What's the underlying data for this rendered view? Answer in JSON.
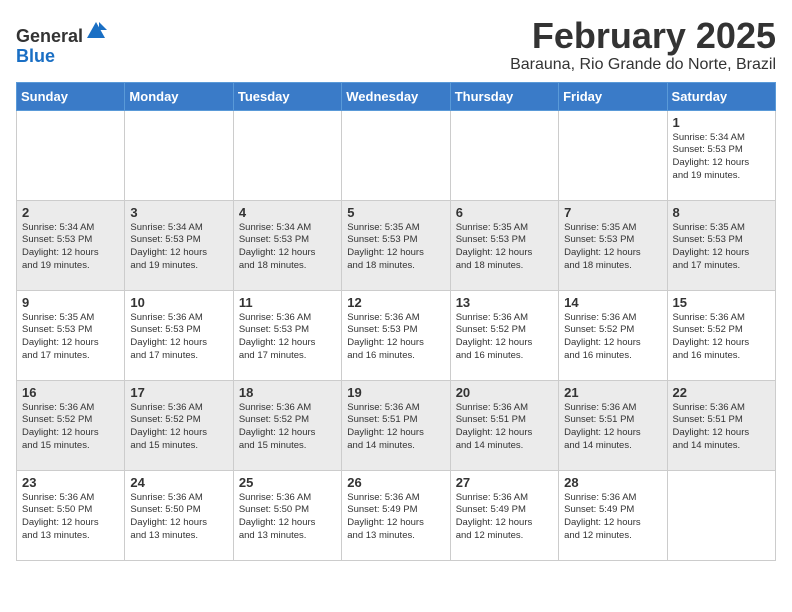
{
  "header": {
    "logo_general": "General",
    "logo_blue": "Blue",
    "month_title": "February 2025",
    "location": "Barauna, Rio Grande do Norte, Brazil"
  },
  "weekdays": [
    "Sunday",
    "Monday",
    "Tuesday",
    "Wednesday",
    "Thursday",
    "Friday",
    "Saturday"
  ],
  "weeks": [
    [
      {
        "day": "",
        "info": ""
      },
      {
        "day": "",
        "info": ""
      },
      {
        "day": "",
        "info": ""
      },
      {
        "day": "",
        "info": ""
      },
      {
        "day": "",
        "info": ""
      },
      {
        "day": "",
        "info": ""
      },
      {
        "day": "1",
        "info": "Sunrise: 5:34 AM\nSunset: 5:53 PM\nDaylight: 12 hours\nand 19 minutes."
      }
    ],
    [
      {
        "day": "2",
        "info": "Sunrise: 5:34 AM\nSunset: 5:53 PM\nDaylight: 12 hours\nand 19 minutes."
      },
      {
        "day": "3",
        "info": "Sunrise: 5:34 AM\nSunset: 5:53 PM\nDaylight: 12 hours\nand 19 minutes."
      },
      {
        "day": "4",
        "info": "Sunrise: 5:34 AM\nSunset: 5:53 PM\nDaylight: 12 hours\nand 18 minutes."
      },
      {
        "day": "5",
        "info": "Sunrise: 5:35 AM\nSunset: 5:53 PM\nDaylight: 12 hours\nand 18 minutes."
      },
      {
        "day": "6",
        "info": "Sunrise: 5:35 AM\nSunset: 5:53 PM\nDaylight: 12 hours\nand 18 minutes."
      },
      {
        "day": "7",
        "info": "Sunrise: 5:35 AM\nSunset: 5:53 PM\nDaylight: 12 hours\nand 18 minutes."
      },
      {
        "day": "8",
        "info": "Sunrise: 5:35 AM\nSunset: 5:53 PM\nDaylight: 12 hours\nand 17 minutes."
      }
    ],
    [
      {
        "day": "9",
        "info": "Sunrise: 5:35 AM\nSunset: 5:53 PM\nDaylight: 12 hours\nand 17 minutes."
      },
      {
        "day": "10",
        "info": "Sunrise: 5:36 AM\nSunset: 5:53 PM\nDaylight: 12 hours\nand 17 minutes."
      },
      {
        "day": "11",
        "info": "Sunrise: 5:36 AM\nSunset: 5:53 PM\nDaylight: 12 hours\nand 17 minutes."
      },
      {
        "day": "12",
        "info": "Sunrise: 5:36 AM\nSunset: 5:53 PM\nDaylight: 12 hours\nand 16 minutes."
      },
      {
        "day": "13",
        "info": "Sunrise: 5:36 AM\nSunset: 5:52 PM\nDaylight: 12 hours\nand 16 minutes."
      },
      {
        "day": "14",
        "info": "Sunrise: 5:36 AM\nSunset: 5:52 PM\nDaylight: 12 hours\nand 16 minutes."
      },
      {
        "day": "15",
        "info": "Sunrise: 5:36 AM\nSunset: 5:52 PM\nDaylight: 12 hours\nand 16 minutes."
      }
    ],
    [
      {
        "day": "16",
        "info": "Sunrise: 5:36 AM\nSunset: 5:52 PM\nDaylight: 12 hours\nand 15 minutes."
      },
      {
        "day": "17",
        "info": "Sunrise: 5:36 AM\nSunset: 5:52 PM\nDaylight: 12 hours\nand 15 minutes."
      },
      {
        "day": "18",
        "info": "Sunrise: 5:36 AM\nSunset: 5:52 PM\nDaylight: 12 hours\nand 15 minutes."
      },
      {
        "day": "19",
        "info": "Sunrise: 5:36 AM\nSunset: 5:51 PM\nDaylight: 12 hours\nand 14 minutes."
      },
      {
        "day": "20",
        "info": "Sunrise: 5:36 AM\nSunset: 5:51 PM\nDaylight: 12 hours\nand 14 minutes."
      },
      {
        "day": "21",
        "info": "Sunrise: 5:36 AM\nSunset: 5:51 PM\nDaylight: 12 hours\nand 14 minutes."
      },
      {
        "day": "22",
        "info": "Sunrise: 5:36 AM\nSunset: 5:51 PM\nDaylight: 12 hours\nand 14 minutes."
      }
    ],
    [
      {
        "day": "23",
        "info": "Sunrise: 5:36 AM\nSunset: 5:50 PM\nDaylight: 12 hours\nand 13 minutes."
      },
      {
        "day": "24",
        "info": "Sunrise: 5:36 AM\nSunset: 5:50 PM\nDaylight: 12 hours\nand 13 minutes."
      },
      {
        "day": "25",
        "info": "Sunrise: 5:36 AM\nSunset: 5:50 PM\nDaylight: 12 hours\nand 13 minutes."
      },
      {
        "day": "26",
        "info": "Sunrise: 5:36 AM\nSunset: 5:49 PM\nDaylight: 12 hours\nand 13 minutes."
      },
      {
        "day": "27",
        "info": "Sunrise: 5:36 AM\nSunset: 5:49 PM\nDaylight: 12 hours\nand 12 minutes."
      },
      {
        "day": "28",
        "info": "Sunrise: 5:36 AM\nSunset: 5:49 PM\nDaylight: 12 hours\nand 12 minutes."
      },
      {
        "day": "",
        "info": ""
      }
    ]
  ]
}
